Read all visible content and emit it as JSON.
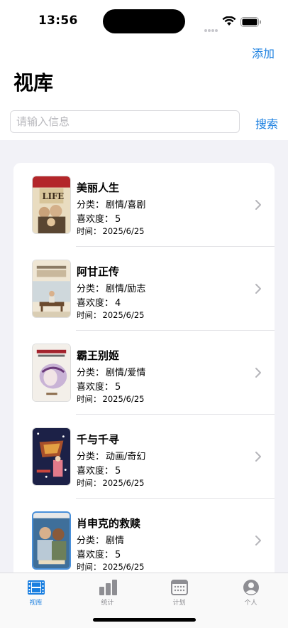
{
  "status_bar": {
    "time": "13:56"
  },
  "header": {
    "add_label": "添加",
    "title": "视库"
  },
  "search": {
    "placeholder": "请输入信息",
    "value": "",
    "button_label": "搜索"
  },
  "labels": {
    "category": "分类：",
    "rating": "喜欢度：",
    "time": "时间："
  },
  "movies": [
    {
      "name": "美丽人生",
      "category": "剧情/喜剧",
      "rating": "5",
      "date": "2025/6/25",
      "poster_icon": "life-is-beautiful-poster"
    },
    {
      "name": "阿甘正传",
      "category": "剧情/励志",
      "rating": "4",
      "date": "2025/6/25",
      "poster_icon": "forrest-gump-poster"
    },
    {
      "name": "霸王别姬",
      "category": "剧情/爱情",
      "rating": "5",
      "date": "2025/6/25",
      "poster_icon": "farewell-my-concubine-poster"
    },
    {
      "name": "千与千寻",
      "category": "动画/奇幻",
      "rating": "5",
      "date": "2025/6/25",
      "poster_icon": "spirited-away-poster"
    },
    {
      "name": "肖申克的救赎",
      "category": "剧情",
      "rating": "5",
      "date": "2025/6/25",
      "poster_icon": "shawshank-poster"
    }
  ],
  "tab_bar": {
    "tabs": [
      {
        "label": "视库",
        "icon": "film-icon",
        "active": true
      },
      {
        "label": "统计",
        "icon": "bar-chart-icon",
        "active": false
      },
      {
        "label": "计划",
        "icon": "calendar-icon",
        "active": false
      },
      {
        "label": "个人",
        "icon": "person-icon",
        "active": false
      }
    ]
  },
  "colors": {
    "accent": "#1a7fe0",
    "background": "#f2f2f7",
    "inactive_tab": "#8e8e93"
  }
}
